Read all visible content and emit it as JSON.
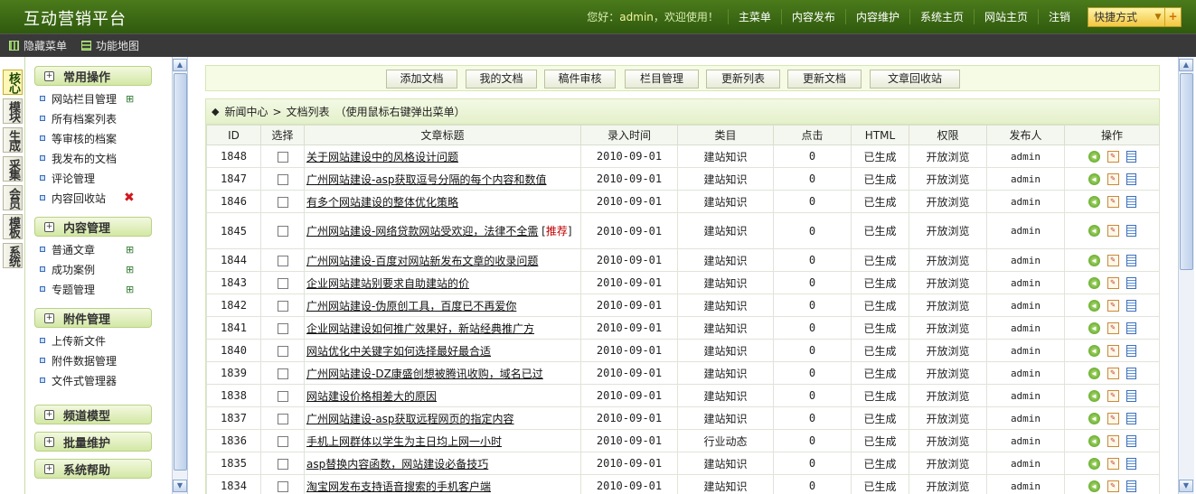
{
  "app": {
    "title": "互动营销平台"
  },
  "topnav": {
    "greeting_prefix": "您好：",
    "username": "admin",
    "greeting_suffix": "，欢迎使用！",
    "items": [
      "主菜单",
      "内容发布",
      "内容维护",
      "系统主页",
      "网站主页",
      "注销"
    ],
    "quick_label": "快捷方式"
  },
  "subbar": {
    "hide_menu": "隐藏菜单",
    "function_map": "功能地图"
  },
  "tabs": [
    "核心",
    "模块",
    "生成",
    "采集",
    "会员",
    "模板",
    "系统"
  ],
  "sidebar": {
    "groups": [
      {
        "title": "常用操作",
        "items": [
          {
            "label": "网站栏目管理",
            "icon": "add-icon"
          },
          {
            "label": "所有档案列表"
          },
          {
            "label": "等审核的档案"
          },
          {
            "label": "我发布的文档"
          },
          {
            "label": "评论管理"
          },
          {
            "label": "内容回收站",
            "icon": "delete-icon"
          }
        ]
      },
      {
        "title": "内容管理",
        "items": [
          {
            "label": "普通文章",
            "icon": "add-icon"
          },
          {
            "label": "成功案例",
            "icon": "add-icon"
          },
          {
            "label": "专题管理",
            "icon": "add-icon"
          }
        ]
      },
      {
        "title": "附件管理",
        "items": [
          {
            "label": "上传新文件"
          },
          {
            "label": "附件数据管理"
          },
          {
            "label": "文件式管理器"
          }
        ]
      },
      {
        "title": "频道模型",
        "items": []
      },
      {
        "title": "批量维护",
        "items": []
      },
      {
        "title": "系统帮助",
        "items": []
      }
    ]
  },
  "toolbar": {
    "buttons": [
      "添加文档",
      "我的文档",
      "稿件审核",
      "栏目管理",
      "更新列表",
      "更新文档",
      "文章回收站"
    ]
  },
  "breadcrumb": {
    "home": "新闻中心",
    "separator": ">",
    "current": "文档列表",
    "hint": "（使用鼠标右键弹出菜单）"
  },
  "table": {
    "headers": [
      "ID",
      "选择",
      "文章标题",
      "录入时间",
      "类目",
      "点击",
      "HTML",
      "权限",
      "发布人",
      "操作"
    ],
    "rows": [
      {
        "id": "1848",
        "title": "关于网站建设中的风格设计问题",
        "date": "2010-09-01",
        "category": "建站知识",
        "clicks": "0",
        "html": "已生成",
        "perm": "开放浏览",
        "publisher": "admin"
      },
      {
        "id": "1847",
        "title": "广州网站建设-asp获取逗号分隔的每个内容和数值",
        "date": "2010-09-01",
        "category": "建站知识",
        "clicks": "0",
        "html": "已生成",
        "perm": "开放浏览",
        "publisher": "admin"
      },
      {
        "id": "1846",
        "title": "有多个网站建设的整体优化策略",
        "date": "2010-09-01",
        "category": "建站知识",
        "clicks": "0",
        "html": "已生成",
        "perm": "开放浏览",
        "publisher": "admin"
      },
      {
        "id": "1845",
        "title": "广州网站建设-网络贷款网站受欢迎，法律不全需",
        "rec_open": "[",
        "rec_text": "推荐",
        "rec_close": "]",
        "date": "2010-09-01",
        "category": "建站知识",
        "clicks": "0",
        "html": "已生成",
        "perm": "开放浏览",
        "publisher": "admin"
      },
      {
        "id": "1844",
        "title": "广州网站建设-百度对网站新发布文章的收录问题",
        "date": "2010-09-01",
        "category": "建站知识",
        "clicks": "0",
        "html": "已生成",
        "perm": "开放浏览",
        "publisher": "admin"
      },
      {
        "id": "1843",
        "title": "企业网站建站别要求自助建站的价",
        "date": "2010-09-01",
        "category": "建站知识",
        "clicks": "0",
        "html": "已生成",
        "perm": "开放浏览",
        "publisher": "admin"
      },
      {
        "id": "1842",
        "title": "广州网站建设-伪原创工具，百度已不再爱你",
        "date": "2010-09-01",
        "category": "建站知识",
        "clicks": "0",
        "html": "已生成",
        "perm": "开放浏览",
        "publisher": "admin"
      },
      {
        "id": "1841",
        "title": "企业网站建设如何推广效果好，新站经典推广方",
        "date": "2010-09-01",
        "category": "建站知识",
        "clicks": "0",
        "html": "已生成",
        "perm": "开放浏览",
        "publisher": "admin"
      },
      {
        "id": "1840",
        "title": "网站优化中关键字如何选择最好最合适",
        "date": "2010-09-01",
        "category": "建站知识",
        "clicks": "0",
        "html": "已生成",
        "perm": "开放浏览",
        "publisher": "admin"
      },
      {
        "id": "1839",
        "title": "广州网站建设-DZ康盛创想被腾讯收购，域名已过",
        "date": "2010-09-01",
        "category": "建站知识",
        "clicks": "0",
        "html": "已生成",
        "perm": "开放浏览",
        "publisher": "admin"
      },
      {
        "id": "1838",
        "title": "网站建设价格相差大的原因",
        "date": "2010-09-01",
        "category": "建站知识",
        "clicks": "0",
        "html": "已生成",
        "perm": "开放浏览",
        "publisher": "admin"
      },
      {
        "id": "1837",
        "title": "广州网站建设-asp获取远程网页的指定内容",
        "date": "2010-09-01",
        "category": "建站知识",
        "clicks": "0",
        "html": "已生成",
        "perm": "开放浏览",
        "publisher": "admin"
      },
      {
        "id": "1836",
        "title": "手机上网群体以学生为主日均上网一小时",
        "date": "2010-09-01",
        "category": "行业动态",
        "clicks": "0",
        "html": "已生成",
        "perm": "开放浏览",
        "publisher": "admin"
      },
      {
        "id": "1835",
        "title": "asp替换内容函数，网站建设必备技巧",
        "date": "2010-09-01",
        "category": "建站知识",
        "clicks": "0",
        "html": "已生成",
        "perm": "开放浏览",
        "publisher": "admin"
      },
      {
        "id": "1834",
        "title": "淘宝网发布支持语音搜索的手机客户端",
        "date": "2010-09-01",
        "category": "建站知识",
        "clicks": "0",
        "html": "已生成",
        "perm": "开放浏览",
        "publisher": "admin"
      }
    ]
  },
  "colors": {
    "header_green": "#3f6e15",
    "subbar": "#393939",
    "accent_yellow": "#f3c640",
    "recommend_red": "#c00000"
  }
}
